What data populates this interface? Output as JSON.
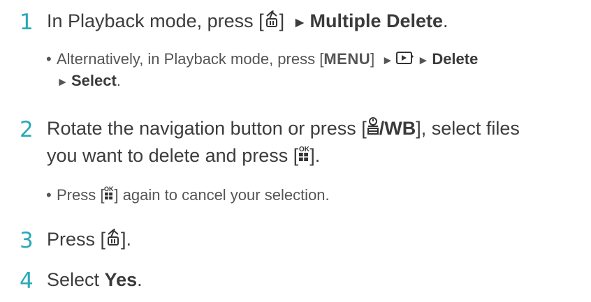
{
  "steps": [
    {
      "number": "1",
      "text_before": "In Playback mode, press [",
      "icon": "trash-icon",
      "text_mid": "] ",
      "arrow": "►",
      "bold": "Multiple Delete",
      "text_after": ".",
      "sub": {
        "bullet": "•",
        "t1": "Alternatively, in Playback mode, press [",
        "menu": "MENU",
        "t2": "] ",
        "arrow1": "►",
        "playback_icon": "playback-menu-icon",
        "arrow2": "►",
        "delete": "Delete",
        "arrow3": "►",
        "select": "Select",
        "end": "."
      }
    },
    {
      "number": "2",
      "line1_a": "Rotate the navigation button or press [",
      "timer_icon": "timer-icon",
      "wb": "/WB",
      "line1_b": "], select files",
      "line2_a": "you want to delete and press [",
      "ok_icon": "ok-button-icon",
      "line2_b": "].",
      "sub": {
        "bullet": "•",
        "t1": "Press [",
        "ok_icon": "ok-button-icon",
        "t2": "] again to cancel your selection."
      }
    },
    {
      "number": "3",
      "t1": "Press [",
      "icon": "trash-icon",
      "t2": "]."
    },
    {
      "number": "4",
      "t1": "Select ",
      "bold": "Yes",
      "t2": "."
    }
  ]
}
